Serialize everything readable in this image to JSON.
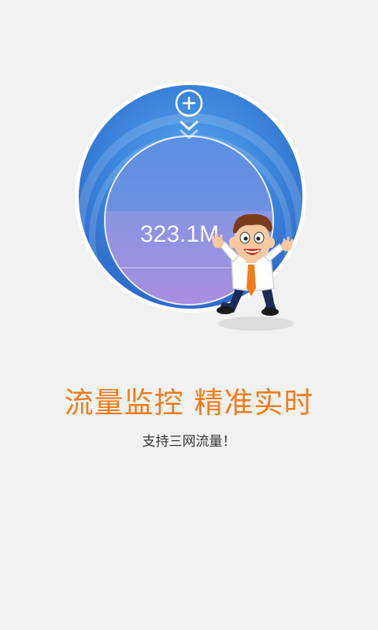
{
  "gauge": {
    "value": "323.1M"
  },
  "headline": "流量监控 精准实时",
  "subtitle": "支持三网流量！",
  "colors": {
    "accent": "#f07d1a",
    "gauge_blue": "#3a7fd6",
    "gauge_purple": "#9a7fd8",
    "background": "#f1f1f1"
  },
  "icons": {
    "add": "add-icon",
    "chevron": "double-chevron-down-icon"
  }
}
